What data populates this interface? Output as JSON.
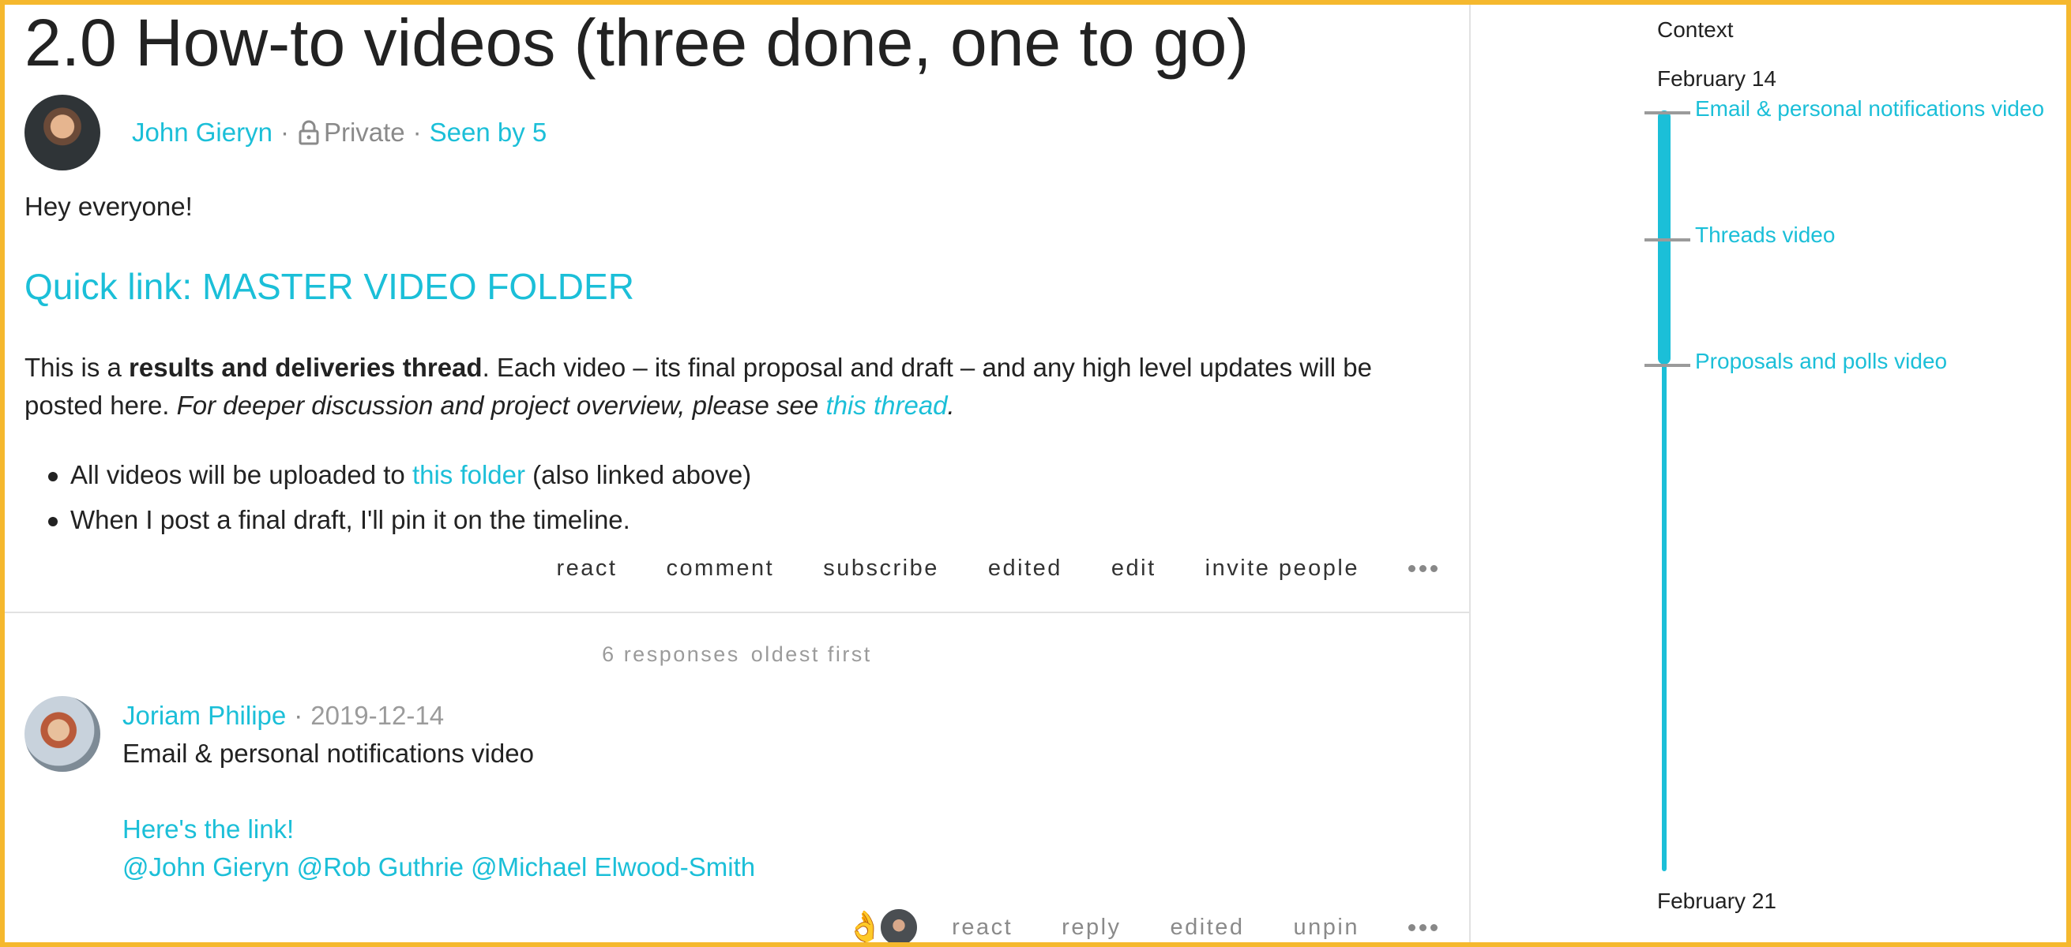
{
  "post": {
    "title": "2.0 How-to videos (three done, one to go)",
    "author": "John Gieryn",
    "sep": "·",
    "privacy": "Private",
    "seen_by": "Seen by 5",
    "greeting": "Hey everyone!",
    "quick_link": "Quick link: MASTER VIDEO FOLDER",
    "para_text1": "This is a ",
    "para_bold": "results and deliveries thread",
    "para_text2": ". Each video – its final proposal and draft – and any high level updates will be posted here. ",
    "para_italic": "For deeper discussion and project overview, please see ",
    "para_link": "this thread",
    "para_end": ".",
    "bullet1_text": "All videos will be uploaded to ",
    "bullet1_link": "this folder",
    "bullet1_end": " (also linked above)",
    "bullet2": "When I post a final draft, I'll pin it on the timeline.",
    "actions": [
      "react",
      "comment",
      "subscribe",
      "edited",
      "edit",
      "invite people"
    ]
  },
  "responses": {
    "count": "6 responses",
    "sort": "oldest first"
  },
  "comment": {
    "author": "Joriam Philipe",
    "date": "2019-12-14",
    "body": "Email & personal notifications video",
    "link": "Here's the link!",
    "mentions": "@John Gieryn @Rob Guthrie @Michael Elwood-Smith",
    "reaction_emoji": "👌",
    "actions": [
      "react",
      "reply",
      "edited",
      "unpin"
    ]
  },
  "sidebar": {
    "title": "Context",
    "date_start": "February 14",
    "date_end": "February 21",
    "items": [
      "Email & personal notifications video",
      "Threads video",
      "Proposals and polls video"
    ]
  },
  "colors": {
    "accent": "#1bbfd8",
    "frame": "#f5b82e"
  },
  "icons": [
    "lock-icon",
    "more-icon",
    "avatar"
  ]
}
